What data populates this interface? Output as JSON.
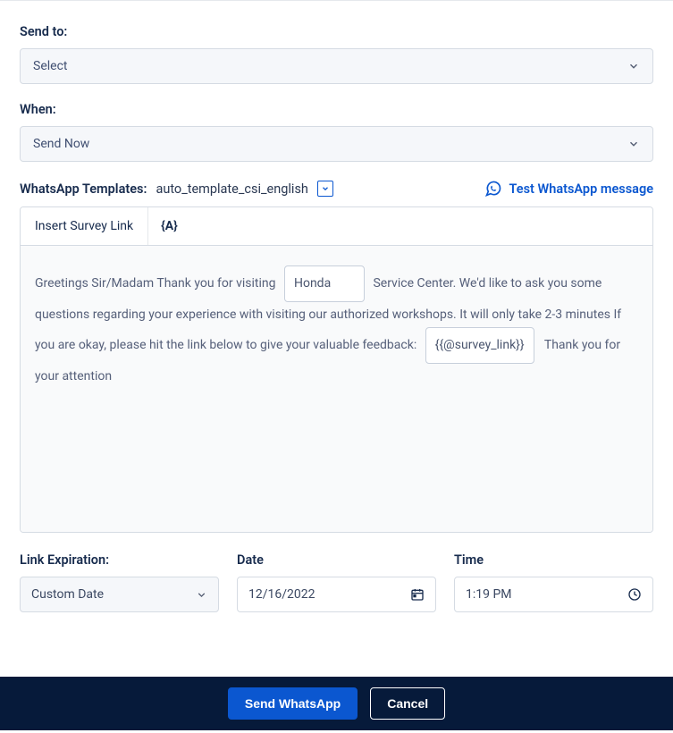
{
  "send_to": {
    "label": "Send to:",
    "value": "Select"
  },
  "when": {
    "label": "When:",
    "value": "Send Now"
  },
  "templates": {
    "label": "WhatsApp Templates:",
    "value": "auto_template_csi_english",
    "test_label": "Test WhatsApp message"
  },
  "toolbar": {
    "insert_link": "Insert Survey Link",
    "variable": "{A}"
  },
  "message": {
    "part1": "Greetings Sir/Madam Thank you for visiting",
    "brand_input": "Honda",
    "part2": "Service Center. We'd like to ask you some questions regarding your experience with visiting our authorized workshops. It will only take 2-3 minutes If you are okay, please hit the link below to give your valuable feedback:",
    "survey_chip": "{{@survey_link}}",
    "part3": "Thank you for your attention"
  },
  "link_exp": {
    "label": "Link Expiration:",
    "value": "Custom Date"
  },
  "date": {
    "label": "Date",
    "value": "12/16/2022"
  },
  "time": {
    "label": "Time",
    "value": "1:19 PM"
  },
  "footer": {
    "send": "Send WhatsApp",
    "cancel": "Cancel"
  }
}
